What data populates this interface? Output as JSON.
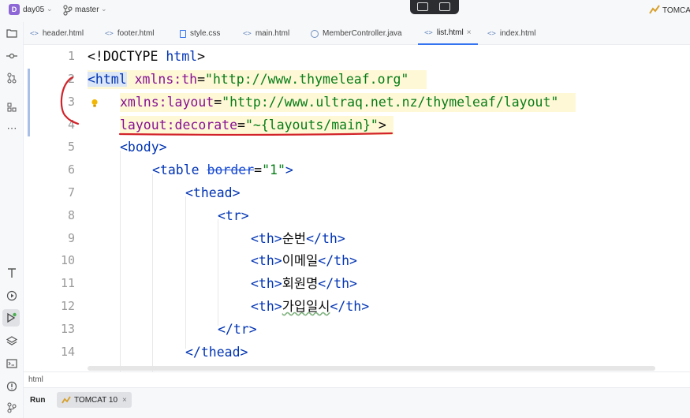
{
  "titlebar": {
    "project_badge": "D",
    "project_name": "day05",
    "branch": "master",
    "run_config": "TOMCAT"
  },
  "tabs": [
    {
      "label": "header.html",
      "icon": "<>",
      "active": false
    },
    {
      "label": "footer.html",
      "icon": "<>",
      "active": false
    },
    {
      "label": "style.css",
      "icon": "css-file-icon",
      "active": false
    },
    {
      "label": "main.html",
      "icon": "<>",
      "active": false
    },
    {
      "label": "MemberController.java",
      "icon": "java-class-icon",
      "active": false
    },
    {
      "label": "list.html",
      "icon": "<>",
      "active": true,
      "close": "×"
    },
    {
      "label": "index.html",
      "icon": "<>",
      "active": false
    }
  ],
  "editor": {
    "line_numbers": [
      "1",
      "2",
      "3",
      "4",
      "5",
      "6",
      "7",
      "8",
      "9",
      "10",
      "11",
      "12",
      "13",
      "14"
    ],
    "lines": {
      "l1": {
        "a": "<!DOCTYPE ",
        "b": "html",
        "c": ">"
      },
      "l2": {
        "tag": "<html",
        "ns": "xmlns:th",
        "eq": "=",
        "val": "\"http://www.thymeleaf.org\""
      },
      "l3": {
        "ns": "xmlns:layout",
        "eq": "=",
        "val": "\"http://www.ultraq.net.nz/thymeleaf/layout\""
      },
      "l4": {
        "ns": "layout",
        "attr": ":decorate",
        "eq": "=",
        "val": "\"~{layouts/main}\"",
        "end": ">"
      },
      "l5": "<body>",
      "l6": {
        "tag": "<table ",
        "attr": "border",
        "eq": "=",
        "val": "\"1\"",
        "end": ">"
      },
      "l7": "<thead>",
      "l8": "<tr>",
      "l9": {
        "open": "<th>",
        "text": "순번",
        "close": "</th>"
      },
      "l10": {
        "open": "<th>",
        "text": "이메일",
        "close": "</th>"
      },
      "l11": {
        "open": "<th>",
        "text": "회원명",
        "close": "</th>"
      },
      "l12": {
        "open": "<th>",
        "text": "가입일시",
        "close": "</th>"
      },
      "l13": "</tr>",
      "l14": "</thead>"
    }
  },
  "breadcrumb": "html",
  "run_panel": {
    "label": "Run",
    "tab": "TOMCAT 10",
    "close": "×"
  },
  "colors": {
    "accent": "#3574f0",
    "tag": "#0033b3",
    "string": "#067d17",
    "namespace": "#871094",
    "annotation_red": "#d2232a"
  }
}
